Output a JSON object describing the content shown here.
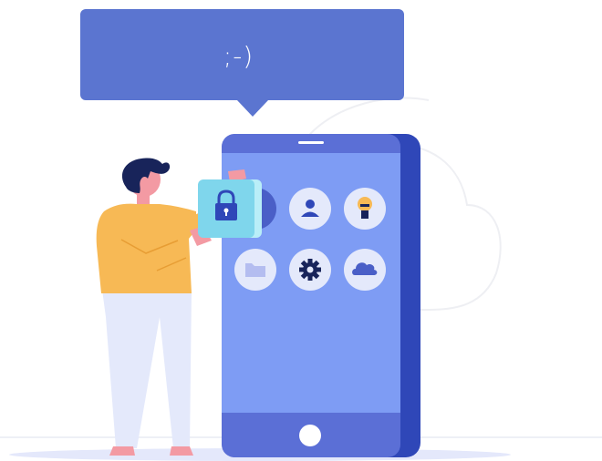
{
  "speech_bubble": {
    "text": ";-)"
  },
  "colors": {
    "bubble": "#5b75d0",
    "phone_body": "#5b6fd6",
    "phone_side": "#2f47b8",
    "phone_screen": "#7e9cf4",
    "shirt": "#f7b955",
    "skin": "#f39aa3",
    "hair": "#18245a",
    "pants": "#e4e9fb",
    "lock_card": "#7fd6ec"
  },
  "icons": [
    "lock-icon",
    "user-icon",
    "lightbulb-icon",
    "folder-icon",
    "gear-icon",
    "cloud-icon",
    "home-button-icon"
  ]
}
